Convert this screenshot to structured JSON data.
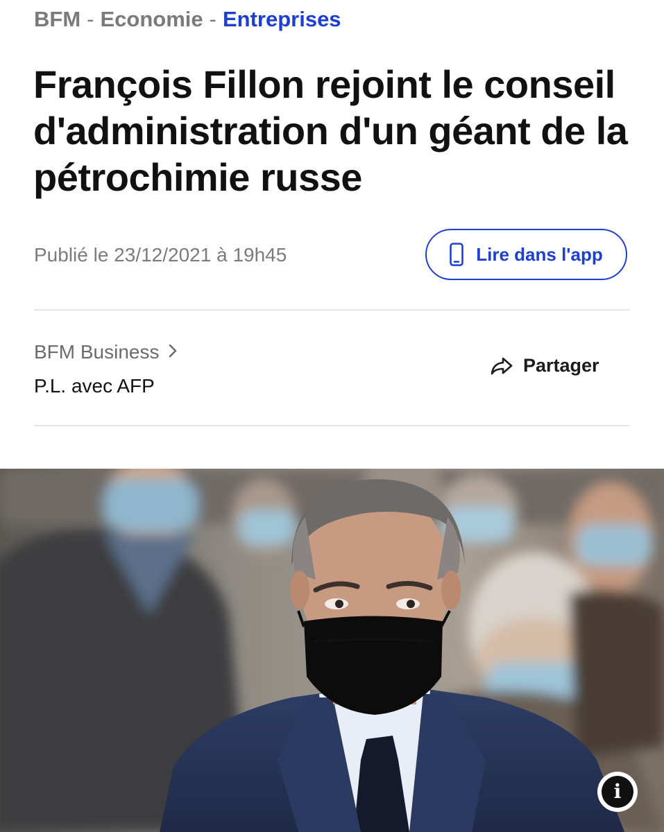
{
  "breadcrumb": {
    "items": [
      "BFM",
      "Economie",
      "Entreprises"
    ],
    "separator": "-"
  },
  "article": {
    "title": "François Fillon rejoint le conseil d'administration d'un géant de la pétrochimie russe",
    "published": "Publié le 23/12/2021 à 19h45",
    "source": "BFM Business",
    "author": "P.L. avec AFP"
  },
  "actions": {
    "read_in_app": "Lire dans l'app",
    "share": "Partager",
    "info": "i"
  },
  "icons": {
    "phone": "smartphone-icon",
    "chevron": "chevron-right-icon",
    "share": "share-arrow-icon",
    "info": "info-icon"
  },
  "colors": {
    "accent": "#1d3fd1",
    "muted_text": "#7a7a7a",
    "divider": "#e4e4e4"
  }
}
